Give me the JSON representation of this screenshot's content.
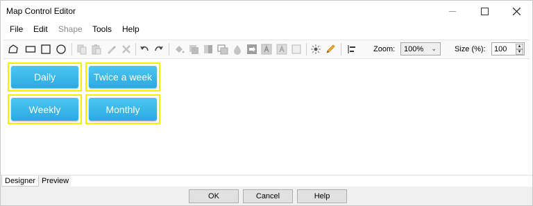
{
  "window": {
    "title": "Map Control Editor"
  },
  "menu": {
    "file": "File",
    "edit": "Edit",
    "shape": "Shape",
    "tools": "Tools",
    "help": "Help"
  },
  "toolbar": {
    "zoom_label": "Zoom:",
    "zoom_value": "100%",
    "size_label": "Size (%):",
    "size_value": "100"
  },
  "tiles": [
    {
      "label": "Daily"
    },
    {
      "label": "Twice a week"
    },
    {
      "label": "Weekly"
    },
    {
      "label": "Monthly"
    }
  ],
  "tabs": {
    "designer": "Designer",
    "preview": "Preview"
  },
  "footer": {
    "ok": "OK",
    "cancel": "Cancel",
    "help": "Help"
  },
  "colors": {
    "tile": "#39b6ea",
    "selection": "#f2ef00"
  }
}
